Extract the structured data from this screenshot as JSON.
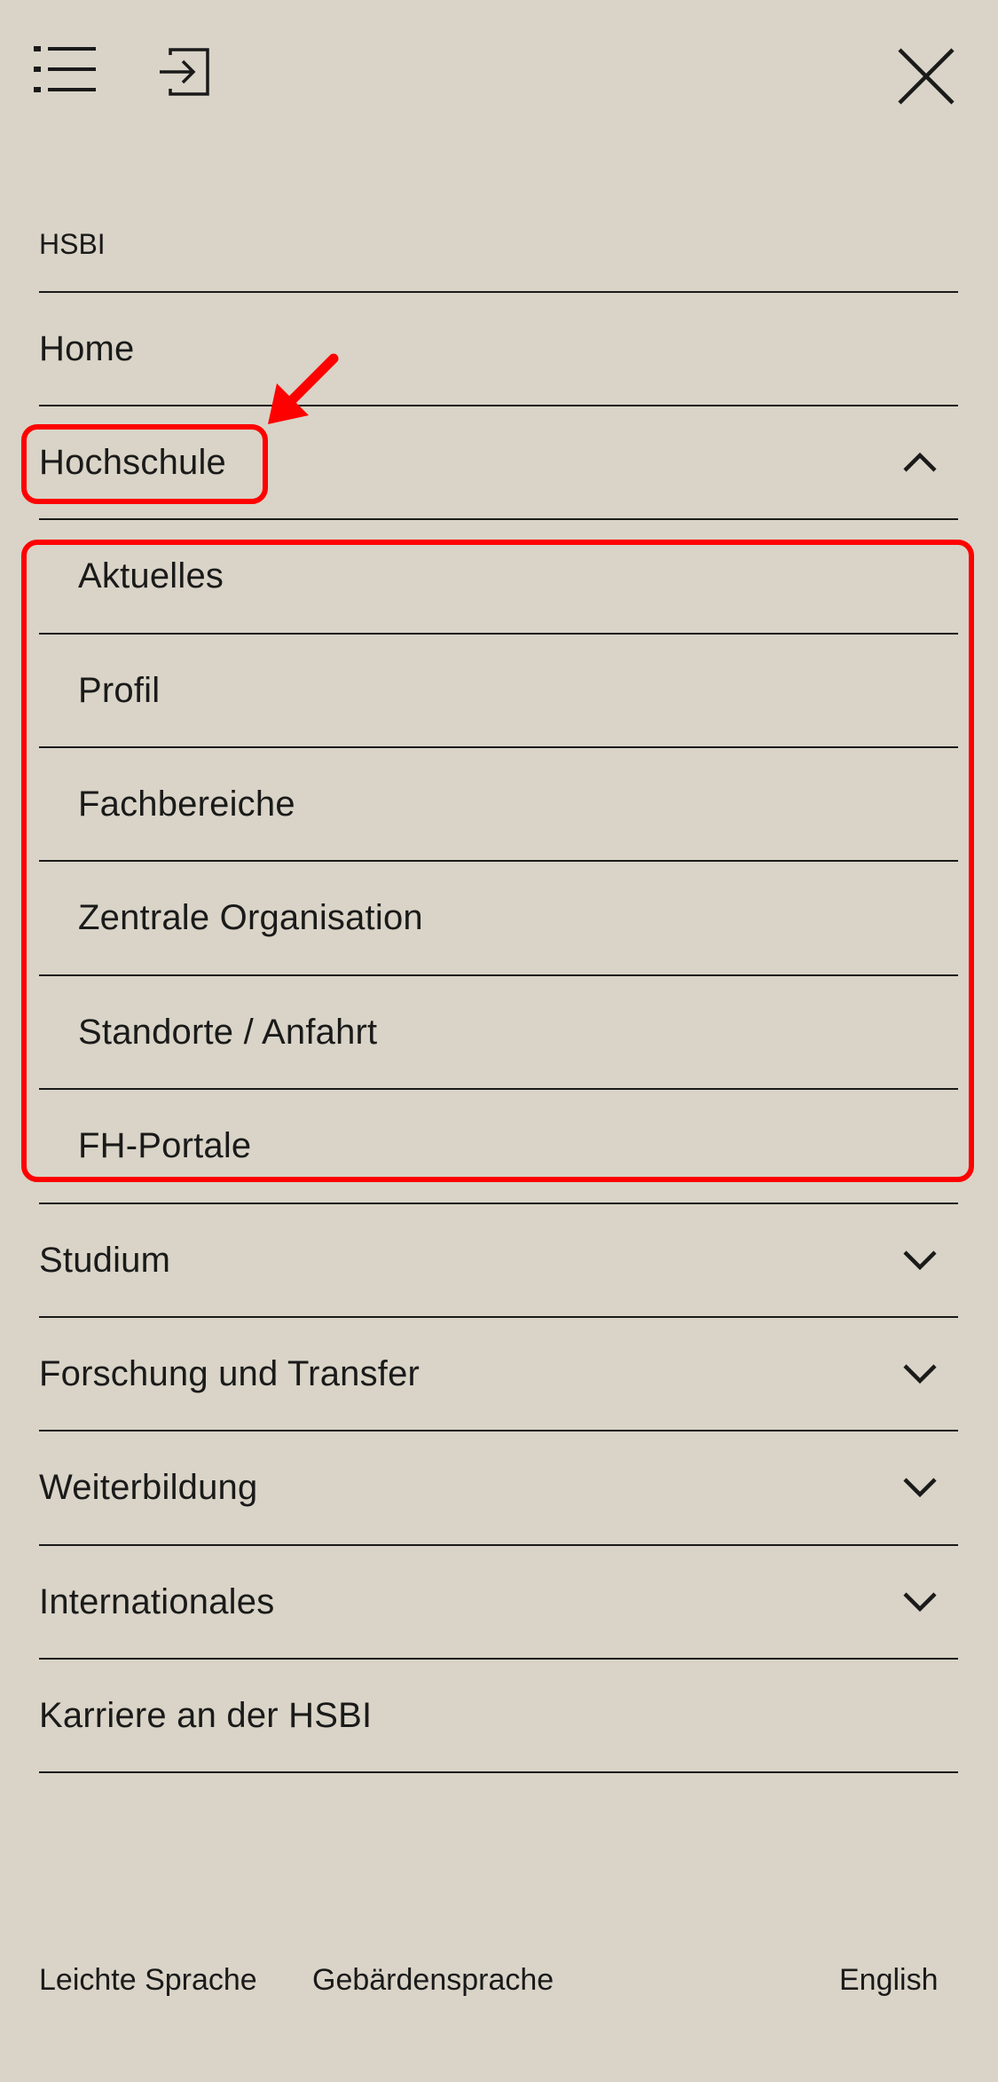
{
  "header": {
    "menu_icon": "list-menu-icon",
    "login_icon": "login-icon",
    "close_icon": "close-icon"
  },
  "nav": {
    "section_title": "HSBI",
    "items": [
      {
        "label": "Home",
        "expandable": false
      },
      {
        "label": "Hochschule",
        "expandable": true,
        "expanded": true
      },
      {
        "label": "Studium",
        "expandable": true,
        "expanded": false
      },
      {
        "label": "Forschung und Transfer",
        "expandable": true,
        "expanded": false
      },
      {
        "label": "Weiterbildung",
        "expandable": true,
        "expanded": false
      },
      {
        "label": "Internationales",
        "expandable": true,
        "expanded": false
      },
      {
        "label": "Karriere an der HSBI",
        "expandable": false
      }
    ],
    "subitems": [
      {
        "label": "Aktuelles"
      },
      {
        "label": "Profil"
      },
      {
        "label": "Fachbereiche"
      },
      {
        "label": "Zentrale Organisation"
      },
      {
        "label": "Standorte / Anfahrt"
      },
      {
        "label": "FH-Portale"
      }
    ]
  },
  "footer": {
    "leichte_sprache": "Leichte Sprache",
    "gebaerdensprache": "Gebärdensprache",
    "english": "English"
  },
  "colors": {
    "background": "#d9d4c7",
    "text": "#1a1a1a",
    "annotation": "#ff0000"
  }
}
